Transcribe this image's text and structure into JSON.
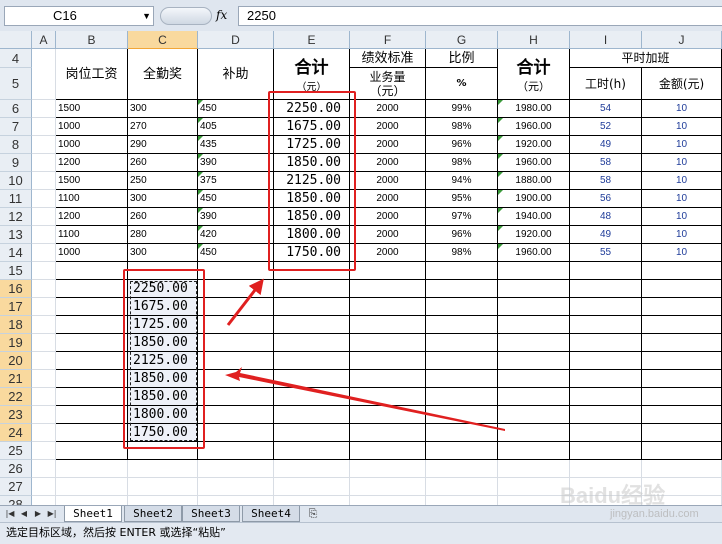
{
  "formula_bar": {
    "cell_ref": "C16",
    "fx_label": "fx",
    "value": "2250"
  },
  "columns": [
    "A",
    "B",
    "C",
    "D",
    "E",
    "F",
    "G",
    "H",
    "I",
    "J"
  ],
  "rows": [
    "4",
    "5",
    "6",
    "7",
    "8",
    "9",
    "10",
    "11",
    "12",
    "13",
    "14",
    "15",
    "16",
    "17",
    "18",
    "19",
    "20",
    "21",
    "22",
    "23",
    "24",
    "25",
    "26",
    "27",
    "28"
  ],
  "headers": {
    "b": "岗位工资",
    "c": "全勤奖",
    "d": "补助",
    "e_main": "合计",
    "e_sub": "（元）",
    "f_main": "绩效标准",
    "f_sub1": "业务量",
    "f_sub2": "（元）",
    "g_main": "比例",
    "g_sub": "%",
    "h_main": "合计",
    "h_sub": "（元）",
    "ij_main": "平时加班",
    "i_sub": "工时(h)",
    "j_sub": "金额(元)"
  },
  "table_rows": [
    {
      "b": "1500",
      "c": "300",
      "d": "450",
      "e": "2250.00",
      "f": "2000",
      "g": "99%",
      "h": "1980.00",
      "i": "54",
      "j": "10"
    },
    {
      "b": "1000",
      "c": "270",
      "d": "405",
      "e": "1675.00",
      "f": "2000",
      "g": "98%",
      "h": "1960.00",
      "i": "52",
      "j": "10"
    },
    {
      "b": "1000",
      "c": "290",
      "d": "435",
      "e": "1725.00",
      "f": "2000",
      "g": "96%",
      "h": "1920.00",
      "i": "49",
      "j": "10"
    },
    {
      "b": "1200",
      "c": "260",
      "d": "390",
      "e": "1850.00",
      "f": "2000",
      "g": "98%",
      "h": "1960.00",
      "i": "58",
      "j": "10"
    },
    {
      "b": "1500",
      "c": "250",
      "d": "375",
      "e": "2125.00",
      "f": "2000",
      "g": "94%",
      "h": "1880.00",
      "i": "58",
      "j": "10"
    },
    {
      "b": "1100",
      "c": "300",
      "d": "450",
      "e": "1850.00",
      "f": "2000",
      "g": "95%",
      "h": "1900.00",
      "i": "56",
      "j": "10"
    },
    {
      "b": "1200",
      "c": "260",
      "d": "390",
      "e": "1850.00",
      "f": "2000",
      "g": "97%",
      "h": "1940.00",
      "i": "48",
      "j": "10"
    },
    {
      "b": "1100",
      "c": "280",
      "d": "420",
      "e": "1800.00",
      "f": "2000",
      "g": "96%",
      "h": "1920.00",
      "i": "49",
      "j": "10"
    },
    {
      "b": "1000",
      "c": "300",
      "d": "450",
      "e": "1750.00",
      "f": "2000",
      "g": "98%",
      "h": "1960.00",
      "i": "55",
      "j": "10"
    }
  ],
  "pasted_values": [
    "2250.00",
    "1675.00",
    "1725.00",
    "1850.00",
    "2125.00",
    "1850.00",
    "1850.00",
    "1800.00",
    "1750.00"
  ],
  "sheet_tabs": [
    "Sheet1",
    "Sheet2",
    "Sheet3",
    "Sheet4"
  ],
  "active_sheet": "Sheet1",
  "status_text": "选定目标区域，然后按 ENTER 或选择“粘贴”",
  "watermark": {
    "brand": "Baidu经验",
    "url": "jingyan.baidu.com"
  },
  "colors": {
    "annotation": "#e02020",
    "selected_header": "#f9d99e",
    "grid_line": "#d8dde4"
  }
}
